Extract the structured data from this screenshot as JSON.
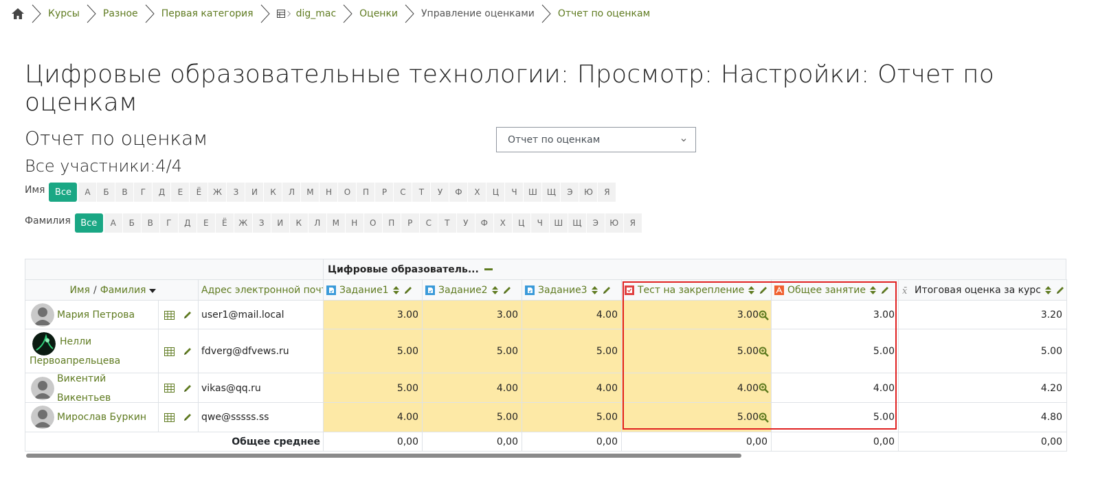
{
  "breadcrumb": [
    {
      "label": "Курсы"
    },
    {
      "label": "Разное"
    },
    {
      "label": "Первая категория"
    },
    {
      "label": "dig_mac",
      "icon": "table-icon",
      "plain": false
    },
    {
      "label": "Оценки"
    },
    {
      "label": "Управление оценками",
      "plain": true
    },
    {
      "label": "Отчет по оценкам"
    }
  ],
  "page_title": "Цифровые образовательные технологии: Просмотр: Настройки: Отчет по оценкам",
  "report_heading": "Отчет по оценкам",
  "participants": "Все участники:4/4",
  "report_select": {
    "value": "Отчет по оценкам"
  },
  "initials": {
    "first_label": "Имя",
    "last_label": "Фамилия",
    "all_label": "Все",
    "letters": [
      "А",
      "Б",
      "В",
      "Г",
      "Д",
      "Е",
      "Ё",
      "Ж",
      "З",
      "И",
      "К",
      "Л",
      "М",
      "Н",
      "О",
      "П",
      "Р",
      "С",
      "Т",
      "У",
      "Ф",
      "Х",
      "Ц",
      "Ч",
      "Ш",
      "Щ",
      "Э",
      "Ю",
      "Я"
    ]
  },
  "table": {
    "category": "Цифровые образователь...",
    "name_header_first": "Имя",
    "name_header_sep": " / ",
    "name_header_last": "Фамилия",
    "email_header": "Адрес электронной почты",
    "columns": [
      {
        "label": "Задание1",
        "icon": "assignment-icon"
      },
      {
        "label": "Задание2",
        "icon": "assignment-icon"
      },
      {
        "label": "Задание3",
        "icon": "assignment-icon"
      },
      {
        "label": "Тест на закрепление",
        "icon": "quiz-icon"
      },
      {
        "label": "Общее занятие",
        "icon": "lesson-icon"
      },
      {
        "label": "Итоговая оценка за курс",
        "icon": "sigma-icon"
      }
    ],
    "rows": [
      {
        "name": "Мария Петрова",
        "email": "user1@mail.local",
        "grades": [
          "3.00",
          "3.00",
          "4.00",
          "3.00",
          "3.00",
          "3.20"
        ]
      },
      {
        "name_line1": "Нелли",
        "name_line2": "Первоапрельцева",
        "email": "fdverg@dfvews.ru",
        "grades": [
          "5.00",
          "5.00",
          "5.00",
          "5.00",
          "5.00",
          "5.00"
        ]
      },
      {
        "name": "Викентий Викентьев",
        "email": "vikas@qq.ru",
        "grades": [
          "5.00",
          "4.00",
          "4.00",
          "4.00",
          "4.00",
          "4.20"
        ]
      },
      {
        "name": "Мирослав Буркин",
        "email": "qwe@sssss.ss",
        "grades": [
          "4.00",
          "5.00",
          "5.00",
          "5.00",
          "5.00",
          "4.80"
        ]
      }
    ],
    "overall_label": "Общее среднее",
    "overall": [
      "0,00",
      "0,00",
      "0,00",
      "0,00",
      "0,00",
      "0,00"
    ]
  },
  "colors": {
    "link": "#5e7a1f",
    "accent": "#1aa784",
    "highlight": "#e02020",
    "grade_bg": "#fde9a6"
  }
}
